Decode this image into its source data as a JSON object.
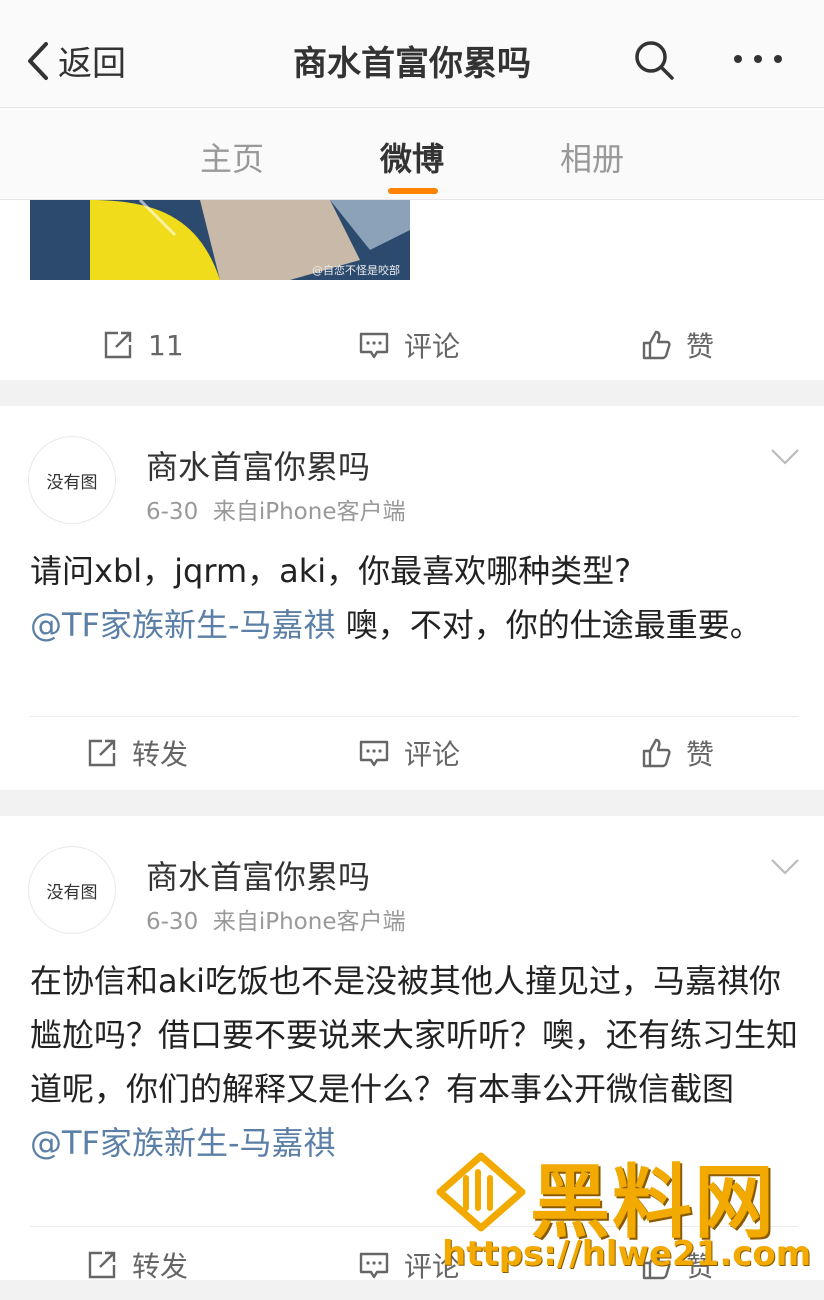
{
  "nav": {
    "back_label": "返回",
    "title": "商水首富你累吗"
  },
  "tabs": [
    {
      "label": "主页"
    },
    {
      "label": "微博"
    },
    {
      "label": "相册"
    }
  ],
  "post1": {
    "image_watermark": "@自恋不怪是咬部",
    "actions": {
      "repost": "11",
      "comment": "评论",
      "like": "赞"
    }
  },
  "post2": {
    "avatar_text": "没有图",
    "username": "商水首富你累吗",
    "date": "6-30",
    "source": "来自iPhone客户端",
    "text_a": "请问xbl，jqrm，aki，你最喜欢哪种类型?",
    "mention": "@TF家族新生-马嘉祺",
    "text_b": " 噢，不对，你的仕途最重要。",
    "actions": {
      "repost": "转发",
      "comment": "评论",
      "like": "赞"
    }
  },
  "post3": {
    "avatar_text": "没有图",
    "username": "商水首富你累吗",
    "date": "6-30",
    "source": "来自iPhone客户端",
    "text_a": "在协信和aki吃饭也不是没被其他人撞见过，马嘉祺你尴尬吗？借口要不要说来大家听听？噢，还有练习生知道呢，你们的解释又是什么？有本事公开微信截图",
    "mention": "@TF家族新生-马嘉祺",
    "actions": {
      "repost": "转发",
      "comment": "评论",
      "like": "赞"
    }
  },
  "watermark": {
    "title": "黑料网",
    "url": "https://hlwe21.com"
  },
  "colors": {
    "accent": "#ff8200",
    "mention": "#5b7fa6",
    "watermark": "#f2a900"
  }
}
